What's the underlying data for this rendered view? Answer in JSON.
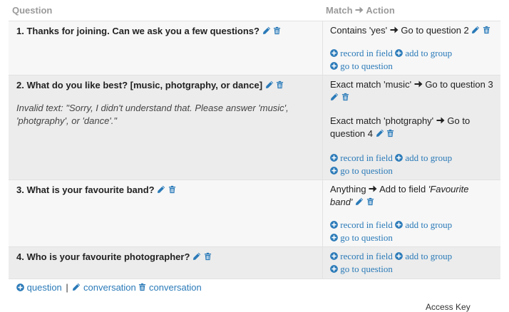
{
  "header": {
    "question": "Question",
    "match": "Match",
    "action": "Action"
  },
  "rows": [
    {
      "question": "1. Thanks for joining. Can we ask you a few questions?",
      "matches": [
        {
          "condition": "Contains 'yes'",
          "action": "Go to question 2"
        }
      ],
      "links": {
        "record": "record in field",
        "group": "add to group",
        "goto": "go to question"
      }
    },
    {
      "question": "2. What do you like best? [music, photgraphy, or dance]",
      "invalid": "Invalid text: \"Sorry, I didn't understand that. Please answer 'music', 'photgraphy', or 'dance'.\"",
      "matches": [
        {
          "condition": "Exact match 'music'",
          "action": "Go to question 3"
        },
        {
          "condition": "Exact match 'photgraphy'",
          "action": "Go to question 4"
        }
      ],
      "links": {
        "record": "record in field",
        "group": "add to group",
        "goto": "go to question"
      }
    },
    {
      "question": "3. What is your favourite band?",
      "matches": [
        {
          "condition": "Anything",
          "action": "Add to field",
          "action_italic": "'Favourite band'"
        }
      ],
      "links": {
        "record": "record in field",
        "group": "add to group",
        "goto": "go to question"
      }
    },
    {
      "question": "4. Who is your favourite photographer?",
      "matches": [],
      "links": {
        "record": "record in field",
        "group": "add to group",
        "goto": "go to question"
      }
    }
  ],
  "footer": {
    "add_question": "question",
    "separator": "|",
    "edit_conversation": "conversation",
    "delete_conversation": "conversation"
  },
  "bottom_partial": "Access Key",
  "colors": {
    "link": "#2a7ab8",
    "row_odd": "#f7f7f7",
    "row_even": "#ececec",
    "header_text": "#9a9a9a"
  }
}
